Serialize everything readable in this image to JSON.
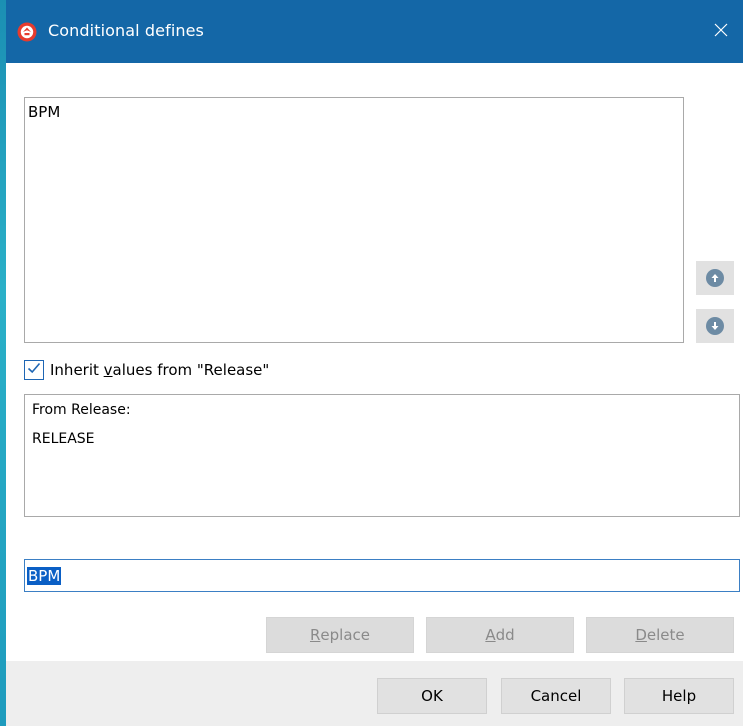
{
  "window": {
    "title": "Conditional defines",
    "icon": "app-logo-icon",
    "close_icon": "close-icon"
  },
  "defines_list": {
    "items": [
      "BPM"
    ]
  },
  "move_buttons": {
    "up_icon": "arrow-up-icon",
    "down_icon": "arrow-down-icon"
  },
  "inherit": {
    "checked": true,
    "label_pre": "Inherit ",
    "label_accel": "v",
    "label_post": "alues from \"Release\""
  },
  "inherited": {
    "header": "From Release:",
    "value": "RELEASE"
  },
  "edit": {
    "value": "BPM"
  },
  "actions": {
    "replace_accel": "R",
    "replace_rest": "eplace",
    "add_accel": "A",
    "add_rest": "dd",
    "delete_accel": "D",
    "delete_rest": "elete"
  },
  "footer": {
    "ok_label": "OK",
    "cancel_label": "Cancel",
    "help_label": "Help"
  },
  "colors": {
    "titlebar": "#1467a7",
    "selection": "#0a5fc5",
    "accent": "#1e66b4"
  }
}
